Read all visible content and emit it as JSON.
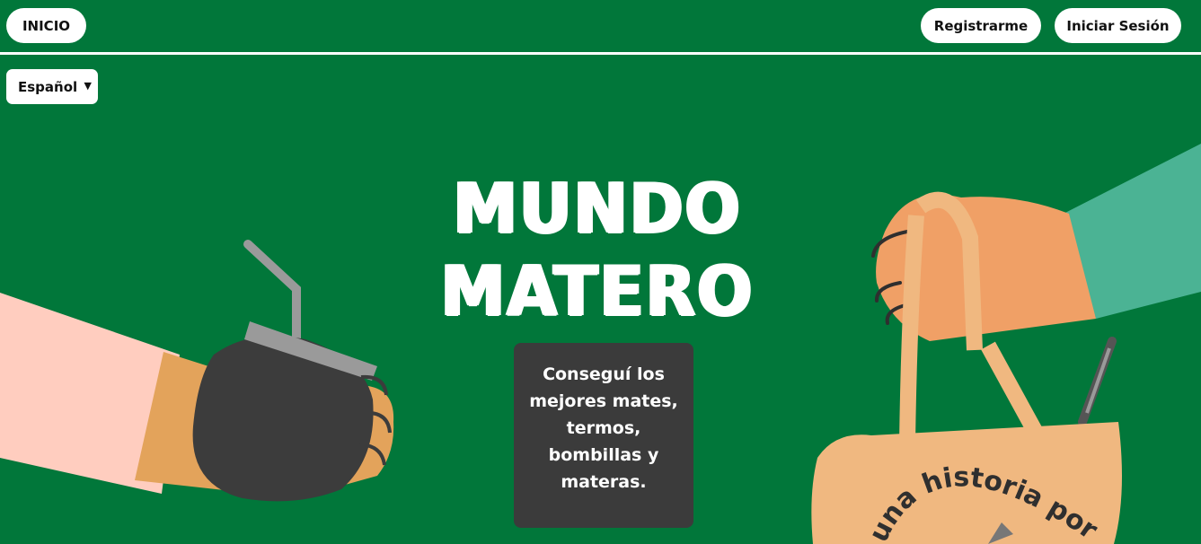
{
  "nav": {
    "home_label": "INICIO",
    "register_label": "Registrarme",
    "login_label": "Iniciar Sesión"
  },
  "language": {
    "selected": "Español"
  },
  "hero": {
    "title_line1": "MUNDO",
    "title_line2": "MATERO",
    "tagline": "Conseguí los mejores mates, termos, bombillas y materas.",
    "bag_text": "una historia por"
  },
  "colors": {
    "background": "#01773a",
    "box": "#3b3b3b",
    "skin": "#f0a066",
    "sleeve_left": "#ffcdbf",
    "sleeve_right": "#4bb394",
    "bag": "#f0b880"
  }
}
